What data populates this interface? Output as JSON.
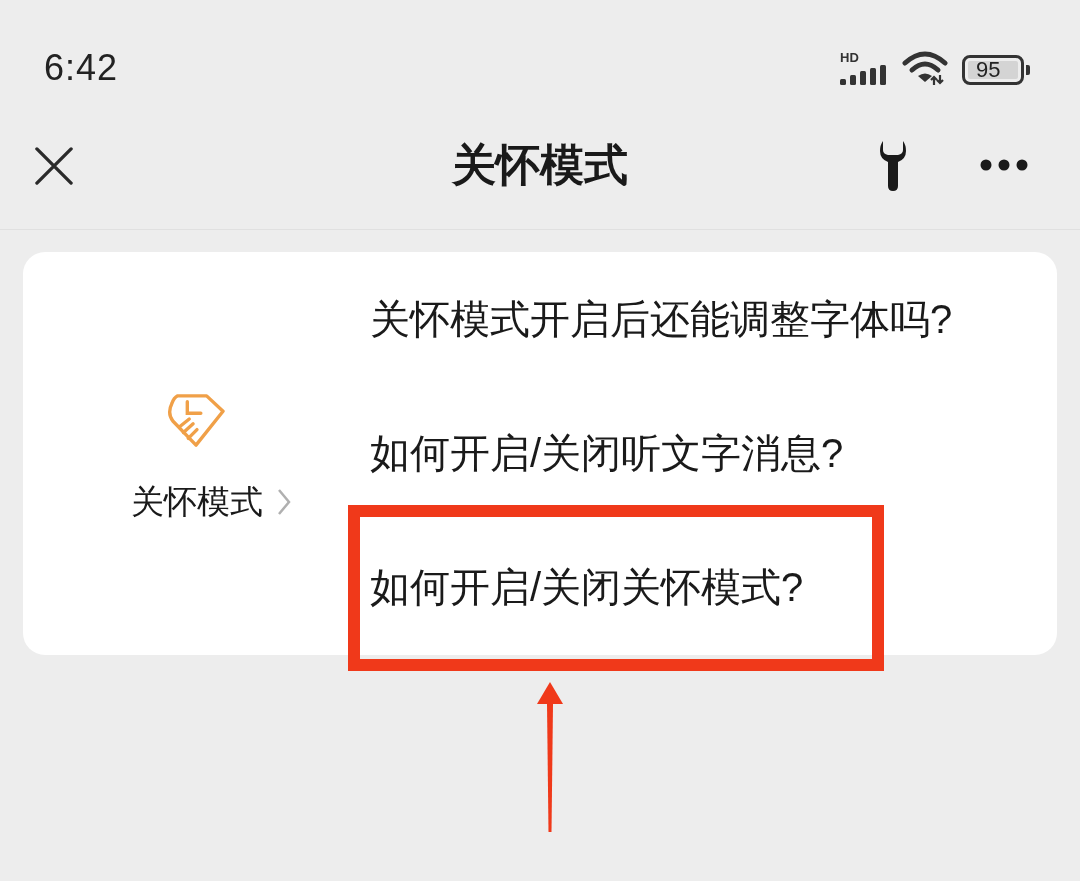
{
  "status_bar": {
    "time": "6:42",
    "network_label": "HD",
    "battery": "95"
  },
  "header": {
    "title": "关怀模式"
  },
  "card": {
    "feature_label": "关怀模式",
    "questions": [
      {
        "text": "关怀模式开启后还能调整字体吗?",
        "highlighted": false
      },
      {
        "text": "如何开启/关闭听文字消息?",
        "highlighted": false
      },
      {
        "text": "如何开启/关闭关怀模式?",
        "highlighted": true
      }
    ]
  }
}
